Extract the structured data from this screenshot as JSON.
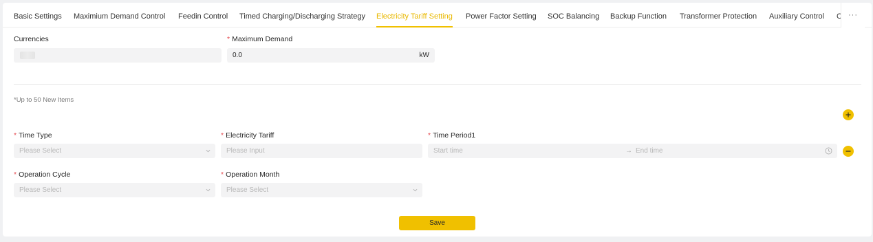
{
  "tabs": [
    {
      "label": "Basic Settings"
    },
    {
      "label": "Maximium Demand Control"
    },
    {
      "label": "Feedin Control"
    },
    {
      "label": "Timed Charging/Discharging Strategy"
    },
    {
      "label": "Electricity Tariff Setting",
      "active": true
    },
    {
      "label": "Power Factor Setting"
    },
    {
      "label": "SOC Balancing"
    },
    {
      "label": "Backup Function"
    },
    {
      "label": "Transformer Protection"
    },
    {
      "label": "Auxiliary Control"
    },
    {
      "label": "C"
    }
  ],
  "tab_more": "···",
  "top_form": {
    "currencies_label": "Currencies",
    "max_demand_label": "Maximum Demand",
    "max_demand_value": "0.0",
    "max_demand_unit": "kW",
    "required_mark": "*"
  },
  "note": "*Up to 50 New Items",
  "item": {
    "time_type_label": "Time Type",
    "time_type_placeholder": "Please Select",
    "tariff_label": "Electricity Tariff",
    "tariff_placeholder": "Please Input",
    "time_period_label": "Time Period1",
    "start_placeholder": "Start time",
    "arrow": "→",
    "end_placeholder": "End time",
    "op_cycle_label": "Operation Cycle",
    "op_cycle_placeholder": "Please Select",
    "op_month_label": "Operation Month",
    "op_month_placeholder": "Please Select"
  },
  "save_label": "Save",
  "colors": {
    "accent": "#f0c000",
    "required": "#e5484d"
  },
  "icons": {
    "add": "plus-circle-icon",
    "remove": "minus-circle-icon",
    "clock": "clock-icon",
    "chevron": "chevron-down-icon"
  }
}
